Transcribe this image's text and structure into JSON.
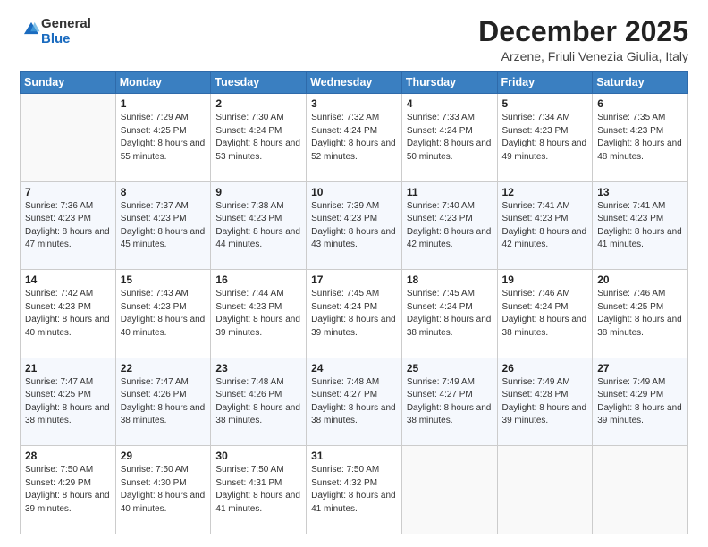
{
  "logo": {
    "general": "General",
    "blue": "Blue"
  },
  "header": {
    "month": "December 2025",
    "location": "Arzene, Friuli Venezia Giulia, Italy"
  },
  "weekdays": [
    "Sunday",
    "Monday",
    "Tuesday",
    "Wednesday",
    "Thursday",
    "Friday",
    "Saturday"
  ],
  "weeks": [
    [
      {
        "day": "",
        "sunrise": "",
        "sunset": "",
        "daylight": ""
      },
      {
        "day": "1",
        "sunrise": "Sunrise: 7:29 AM",
        "sunset": "Sunset: 4:25 PM",
        "daylight": "Daylight: 8 hours and 55 minutes."
      },
      {
        "day": "2",
        "sunrise": "Sunrise: 7:30 AM",
        "sunset": "Sunset: 4:24 PM",
        "daylight": "Daylight: 8 hours and 53 minutes."
      },
      {
        "day": "3",
        "sunrise": "Sunrise: 7:32 AM",
        "sunset": "Sunset: 4:24 PM",
        "daylight": "Daylight: 8 hours and 52 minutes."
      },
      {
        "day": "4",
        "sunrise": "Sunrise: 7:33 AM",
        "sunset": "Sunset: 4:24 PM",
        "daylight": "Daylight: 8 hours and 50 minutes."
      },
      {
        "day": "5",
        "sunrise": "Sunrise: 7:34 AM",
        "sunset": "Sunset: 4:23 PM",
        "daylight": "Daylight: 8 hours and 49 minutes."
      },
      {
        "day": "6",
        "sunrise": "Sunrise: 7:35 AM",
        "sunset": "Sunset: 4:23 PM",
        "daylight": "Daylight: 8 hours and 48 minutes."
      }
    ],
    [
      {
        "day": "7",
        "sunrise": "Sunrise: 7:36 AM",
        "sunset": "Sunset: 4:23 PM",
        "daylight": "Daylight: 8 hours and 47 minutes."
      },
      {
        "day": "8",
        "sunrise": "Sunrise: 7:37 AM",
        "sunset": "Sunset: 4:23 PM",
        "daylight": "Daylight: 8 hours and 45 minutes."
      },
      {
        "day": "9",
        "sunrise": "Sunrise: 7:38 AM",
        "sunset": "Sunset: 4:23 PM",
        "daylight": "Daylight: 8 hours and 44 minutes."
      },
      {
        "day": "10",
        "sunrise": "Sunrise: 7:39 AM",
        "sunset": "Sunset: 4:23 PM",
        "daylight": "Daylight: 8 hours and 43 minutes."
      },
      {
        "day": "11",
        "sunrise": "Sunrise: 7:40 AM",
        "sunset": "Sunset: 4:23 PM",
        "daylight": "Daylight: 8 hours and 42 minutes."
      },
      {
        "day": "12",
        "sunrise": "Sunrise: 7:41 AM",
        "sunset": "Sunset: 4:23 PM",
        "daylight": "Daylight: 8 hours and 42 minutes."
      },
      {
        "day": "13",
        "sunrise": "Sunrise: 7:41 AM",
        "sunset": "Sunset: 4:23 PM",
        "daylight": "Daylight: 8 hours and 41 minutes."
      }
    ],
    [
      {
        "day": "14",
        "sunrise": "Sunrise: 7:42 AM",
        "sunset": "Sunset: 4:23 PM",
        "daylight": "Daylight: 8 hours and 40 minutes."
      },
      {
        "day": "15",
        "sunrise": "Sunrise: 7:43 AM",
        "sunset": "Sunset: 4:23 PM",
        "daylight": "Daylight: 8 hours and 40 minutes."
      },
      {
        "day": "16",
        "sunrise": "Sunrise: 7:44 AM",
        "sunset": "Sunset: 4:23 PM",
        "daylight": "Daylight: 8 hours and 39 minutes."
      },
      {
        "day": "17",
        "sunrise": "Sunrise: 7:45 AM",
        "sunset": "Sunset: 4:24 PM",
        "daylight": "Daylight: 8 hours and 39 minutes."
      },
      {
        "day": "18",
        "sunrise": "Sunrise: 7:45 AM",
        "sunset": "Sunset: 4:24 PM",
        "daylight": "Daylight: 8 hours and 38 minutes."
      },
      {
        "day": "19",
        "sunrise": "Sunrise: 7:46 AM",
        "sunset": "Sunset: 4:24 PM",
        "daylight": "Daylight: 8 hours and 38 minutes."
      },
      {
        "day": "20",
        "sunrise": "Sunrise: 7:46 AM",
        "sunset": "Sunset: 4:25 PM",
        "daylight": "Daylight: 8 hours and 38 minutes."
      }
    ],
    [
      {
        "day": "21",
        "sunrise": "Sunrise: 7:47 AM",
        "sunset": "Sunset: 4:25 PM",
        "daylight": "Daylight: 8 hours and 38 minutes."
      },
      {
        "day": "22",
        "sunrise": "Sunrise: 7:47 AM",
        "sunset": "Sunset: 4:26 PM",
        "daylight": "Daylight: 8 hours and 38 minutes."
      },
      {
        "day": "23",
        "sunrise": "Sunrise: 7:48 AM",
        "sunset": "Sunset: 4:26 PM",
        "daylight": "Daylight: 8 hours and 38 minutes."
      },
      {
        "day": "24",
        "sunrise": "Sunrise: 7:48 AM",
        "sunset": "Sunset: 4:27 PM",
        "daylight": "Daylight: 8 hours and 38 minutes."
      },
      {
        "day": "25",
        "sunrise": "Sunrise: 7:49 AM",
        "sunset": "Sunset: 4:27 PM",
        "daylight": "Daylight: 8 hours and 38 minutes."
      },
      {
        "day": "26",
        "sunrise": "Sunrise: 7:49 AM",
        "sunset": "Sunset: 4:28 PM",
        "daylight": "Daylight: 8 hours and 39 minutes."
      },
      {
        "day": "27",
        "sunrise": "Sunrise: 7:49 AM",
        "sunset": "Sunset: 4:29 PM",
        "daylight": "Daylight: 8 hours and 39 minutes."
      }
    ],
    [
      {
        "day": "28",
        "sunrise": "Sunrise: 7:50 AM",
        "sunset": "Sunset: 4:29 PM",
        "daylight": "Daylight: 8 hours and 39 minutes."
      },
      {
        "day": "29",
        "sunrise": "Sunrise: 7:50 AM",
        "sunset": "Sunset: 4:30 PM",
        "daylight": "Daylight: 8 hours and 40 minutes."
      },
      {
        "day": "30",
        "sunrise": "Sunrise: 7:50 AM",
        "sunset": "Sunset: 4:31 PM",
        "daylight": "Daylight: 8 hours and 41 minutes."
      },
      {
        "day": "31",
        "sunrise": "Sunrise: 7:50 AM",
        "sunset": "Sunset: 4:32 PM",
        "daylight": "Daylight: 8 hours and 41 minutes."
      },
      {
        "day": "",
        "sunrise": "",
        "sunset": "",
        "daylight": ""
      },
      {
        "day": "",
        "sunrise": "",
        "sunset": "",
        "daylight": ""
      },
      {
        "day": "",
        "sunrise": "",
        "sunset": "",
        "daylight": ""
      }
    ]
  ]
}
